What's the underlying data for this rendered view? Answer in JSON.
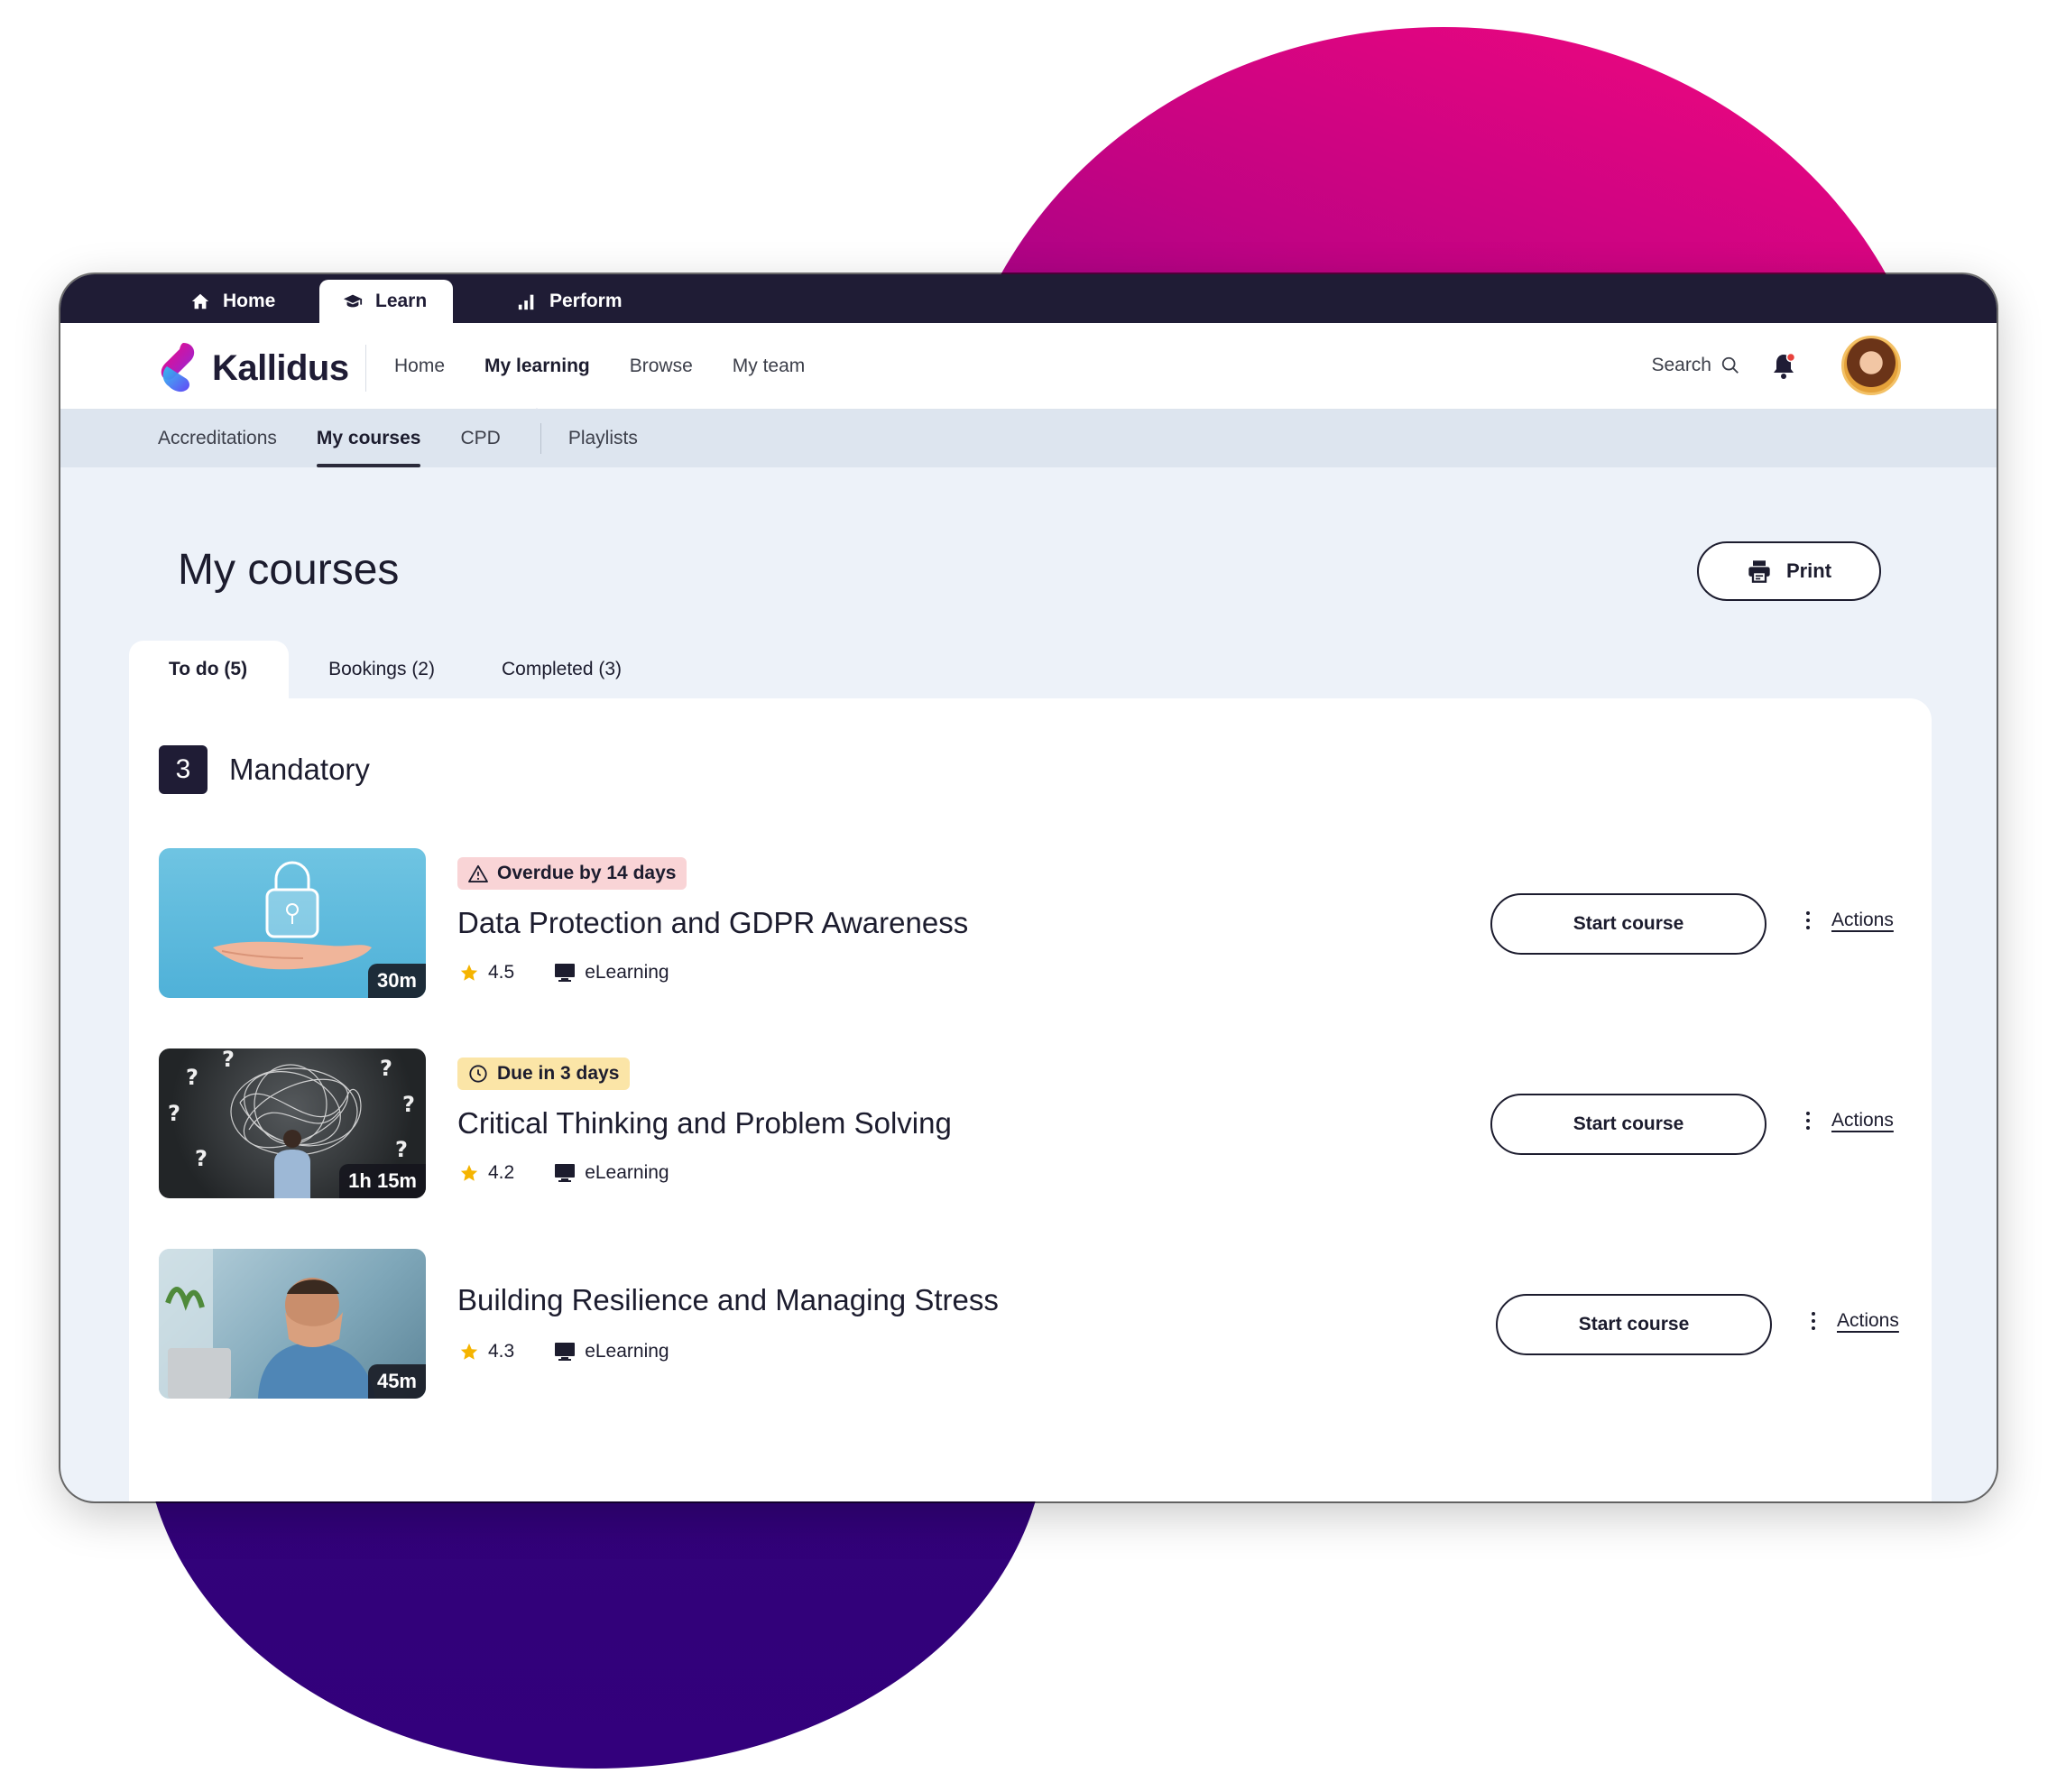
{
  "colors": {
    "topbar": "#1f1c35",
    "brand_pink": "#f4077f",
    "brand_purple": "#33007c",
    "overdue_badge": "#f9d4d6",
    "due_badge": "#fbe5a7",
    "star": "#f5b400",
    "notification_dot": "#e8413c"
  },
  "topbar": {
    "tabs": [
      {
        "label": "Home",
        "icon": "home-icon",
        "active": false
      },
      {
        "label": "Learn",
        "icon": "graduation-cap-icon",
        "active": true
      },
      {
        "label": "Perform",
        "icon": "bar-chart-icon",
        "active": false
      }
    ]
  },
  "header": {
    "logo_text": "Kallidus",
    "nav": [
      "Home",
      "My learning",
      "Browse",
      "My team"
    ],
    "active_nav": "My learning",
    "search_label": "Search",
    "search_icon": "search-icon",
    "bell_icon": "bell-icon"
  },
  "subnav": {
    "items": [
      "Accreditations",
      "My courses",
      "CPD",
      "Playlists"
    ],
    "active": "My courses"
  },
  "page": {
    "title": "My courses",
    "print_label": "Print",
    "print_icon": "printer-icon"
  },
  "tabs": [
    {
      "label": "To do (5)",
      "active": true
    },
    {
      "label": "Bookings (2)",
      "active": false
    },
    {
      "label": "Completed (3)",
      "active": false
    }
  ],
  "section": {
    "count": "3",
    "title": "Mandatory"
  },
  "courses": [
    {
      "badge": "Overdue by 14 days",
      "badge_type": "overdue",
      "badge_icon": "warning-icon",
      "title": "Data Protection and GDPR Awareness",
      "rating": "4.5",
      "type": "eLearning",
      "duration": "30m",
      "start_label": "Start course",
      "actions_label": "Actions"
    },
    {
      "badge": "Due in 3 days",
      "badge_type": "due",
      "badge_icon": "clock-icon",
      "title": "Critical Thinking and Problem Solving",
      "rating": "4.2",
      "type": "eLearning",
      "duration": "1h 15m",
      "start_label": "Start course",
      "actions_label": "Actions"
    },
    {
      "badge": "",
      "badge_type": "none",
      "title": "Building Resilience and Managing Stress",
      "rating": "4.3",
      "type": "eLearning",
      "duration": "45m",
      "start_label": "Start course",
      "actions_label": "Actions"
    }
  ]
}
